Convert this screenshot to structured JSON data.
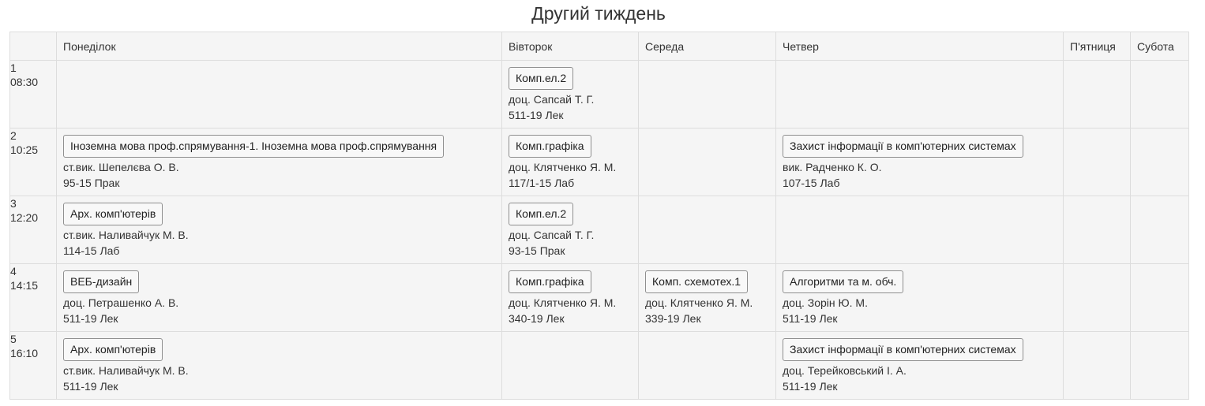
{
  "title": "Другий тиждень",
  "days": [
    "",
    "Понеділок",
    "Вівторок",
    "Середа",
    "Четвер",
    "П'ятниця",
    "Субота"
  ],
  "rows": [
    {
      "num": "1",
      "time": "08:30",
      "cells": [
        null,
        {
          "subject": "Комп.ел.2",
          "teacher": "доц. Сапсай Т. Г.",
          "room": "511-19 Лек"
        },
        null,
        null,
        null,
        null
      ]
    },
    {
      "num": "2",
      "time": "10:25",
      "cells": [
        {
          "subject": "Іноземна мова проф.спрямування-1. Іноземна мова проф.спрямування",
          "teacher": "ст.вик. Шепелєва О. В.",
          "room": "95-15 Прак"
        },
        {
          "subject": "Комп.графіка",
          "teacher": "доц. Клятченко Я. М.",
          "room": "117/1-15 Лаб"
        },
        null,
        {
          "subject": "Захист інформації в комп'ютерних системах",
          "teacher": "вик. Радченко К. О.",
          "room": "107-15 Лаб"
        },
        null,
        null
      ]
    },
    {
      "num": "3",
      "time": "12:20",
      "cells": [
        {
          "subject": "Арх. комп'ютерів",
          "teacher": "ст.вик. Наливайчук М. В.",
          "room": "114-15 Лаб"
        },
        {
          "subject": "Комп.ел.2",
          "teacher": "доц. Сапсай Т. Г.",
          "room": "93-15 Прак"
        },
        null,
        null,
        null,
        null
      ]
    },
    {
      "num": "4",
      "time": "14:15",
      "cells": [
        {
          "subject": "ВЕБ-дизайн",
          "teacher": "доц. Петрашенко А. В.",
          "room": "511-19 Лек"
        },
        {
          "subject": "Комп.графіка",
          "teacher": "доц. Клятченко Я. М.",
          "room": "340-19 Лек"
        },
        {
          "subject": "Комп. схемотех.1",
          "teacher": "доц. Клятченко Я. М.",
          "room": "339-19 Лек"
        },
        {
          "subject": "Алгоритми та м. обч.",
          "teacher": "доц. Зорін Ю. М.",
          "room": "511-19 Лек"
        },
        null,
        null
      ]
    },
    {
      "num": "5",
      "time": "16:10",
      "cells": [
        {
          "subject": "Арх. комп'ютерів",
          "teacher": "ст.вик. Наливайчук М. В.",
          "room": "511-19 Лек"
        },
        null,
        null,
        {
          "subject": "Захист інформації в комп'ютерних системах",
          "teacher": "доц. Терейковський І. А.",
          "room": "511-19 Лек"
        },
        null,
        null
      ]
    }
  ]
}
